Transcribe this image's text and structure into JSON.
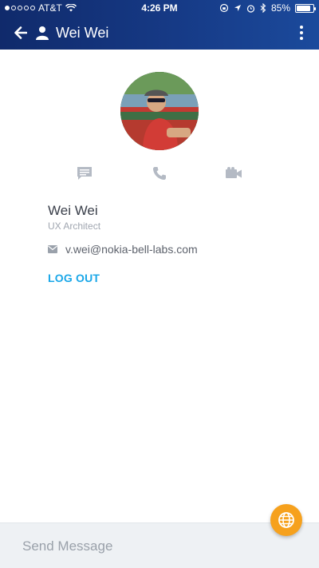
{
  "status_bar": {
    "carrier": "AT&T",
    "time": "4:26 PM",
    "battery": "85%",
    "battery_level": 0.85,
    "signal_bars_filled": 1,
    "signal_bars_total": 5
  },
  "app_bar": {
    "title": "Wei Wei",
    "back_icon": "arrow-left-icon",
    "person_icon": "person-icon",
    "menu_icon": "more-vertical-icon"
  },
  "profile": {
    "name": "Wei Wei",
    "role": "UX Architect",
    "email": "v.wei@nokia-bell-labs.com",
    "logout_label": "LOG OUT"
  },
  "actions": {
    "message_icon": "chat-icon",
    "call_icon": "phone-icon",
    "video_icon": "video-icon"
  },
  "composer": {
    "placeholder": "Send Message",
    "value": ""
  },
  "fab": {
    "icon": "globe-icon"
  },
  "colors": {
    "appbar": "#163a86",
    "accent": "#1aa7e8",
    "fab": "#f6a11d",
    "icon_gray": "#b4bac4"
  }
}
